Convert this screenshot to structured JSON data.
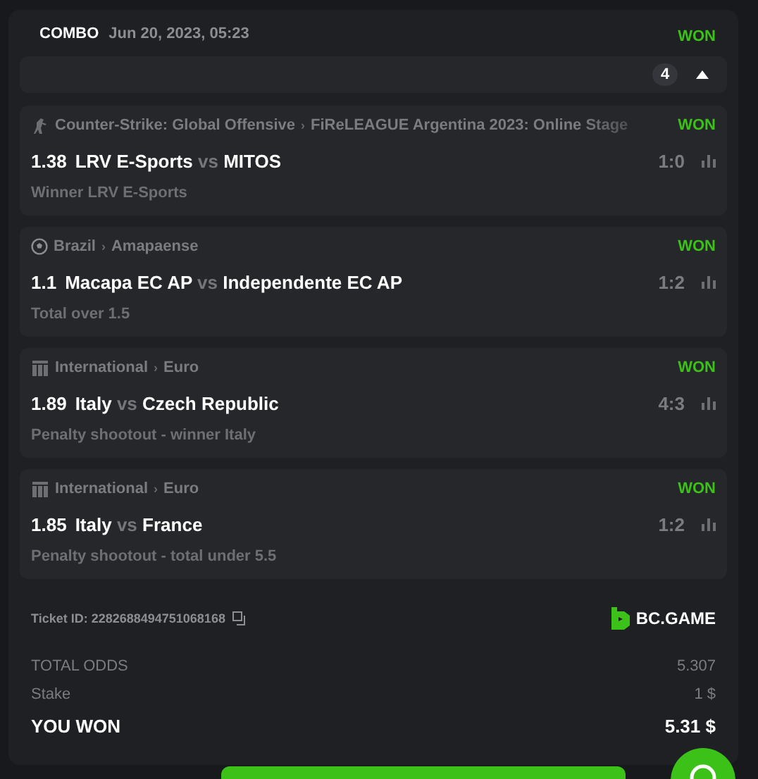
{
  "header": {
    "type": "COMBO",
    "date": "Jun 20, 2023, 05:23",
    "status": "WON"
  },
  "selection_count": "4",
  "expanded": true,
  "events": [
    {
      "kind": "esports",
      "category": "Counter-Strike: Global Offensive",
      "separator": "›",
      "league": "FiReLEAGUE Argentina 2023: Online Stage",
      "status": "WON",
      "odds": "1.38",
      "home": "LRV E-Sports",
      "vs": "vs",
      "away": "MITOS",
      "score": "1:0",
      "market": "Winner LRV E-Sports"
    },
    {
      "kind": "football",
      "category": "Brazil",
      "separator": "›",
      "league": "Amapaense",
      "status": "WON",
      "odds": "1.1",
      "home": "Macapa EC AP",
      "vs": "vs",
      "away": "Independente EC AP",
      "score": "1:2",
      "market": "Total over 1.5"
    },
    {
      "kind": "efootball",
      "category": "International",
      "separator": "›",
      "league": "Euro",
      "status": "WON",
      "odds": "1.89",
      "home": "Italy",
      "vs": "vs",
      "away": "Czech Republic",
      "score": "4:3",
      "market": "Penalty shootout - winner Italy"
    },
    {
      "kind": "efootball",
      "category": "International",
      "separator": "›",
      "league": "Euro",
      "status": "WON",
      "odds": "1.85",
      "home": "Italy",
      "vs": "vs",
      "away": "France",
      "score": "1:2",
      "market": "Penalty shootout - total under 5.5"
    }
  ],
  "ticket": "Ticket ID: 2282688494751068168",
  "brand": "BC.GAME",
  "totals": [
    {
      "kind": "muted",
      "label": "TOTAL ODDS",
      "value": "5.307"
    },
    {
      "kind": "muted",
      "label": "Stake",
      "value": "1 $"
    },
    {
      "kind": "strong",
      "label": "YOU WON",
      "value": "5.31 $"
    }
  ]
}
